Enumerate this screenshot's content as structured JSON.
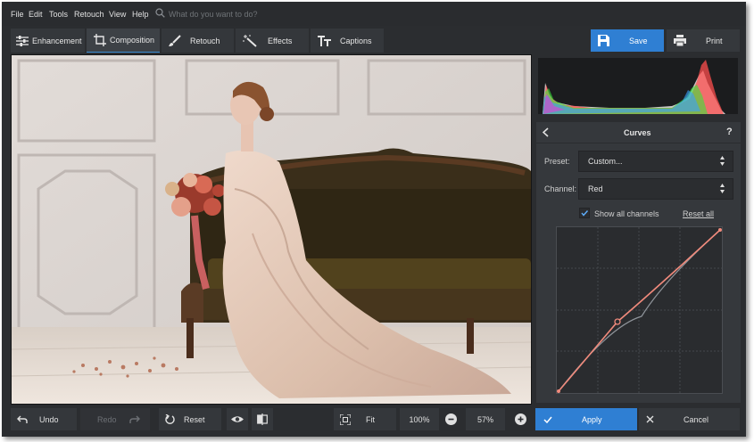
{
  "menu": [
    "File",
    "Edit",
    "Tools",
    "Retouch",
    "View",
    "Help"
  ],
  "search": {
    "placeholder": "What do you want to do?"
  },
  "tabs": {
    "enhancement": "Enhancement",
    "composition": "Composition",
    "retouch": "Retouch",
    "effects": "Effects",
    "captions": "Captions"
  },
  "actions": {
    "save": "Save",
    "print": "Print"
  },
  "curves": {
    "title": "Curves",
    "help": "?",
    "preset_label": "Preset:",
    "preset_value": "Custom...",
    "channel_label": "Channel:",
    "channel_value": "Red",
    "show_all_channels": "Show all channels",
    "show_all_checked": true,
    "reset_all": "Reset all"
  },
  "bottom": {
    "undo": "Undo",
    "redo": "Redo",
    "reset": "Reset",
    "fit": "Fit",
    "zoom_100": "100%",
    "zoom_value": "57%",
    "apply": "Apply",
    "cancel": "Cancel"
  },
  "colors": {
    "accent": "#2f7fd3",
    "curve_red": "#f08a7c",
    "panel": "#35383c",
    "background": "#2b2d30"
  }
}
